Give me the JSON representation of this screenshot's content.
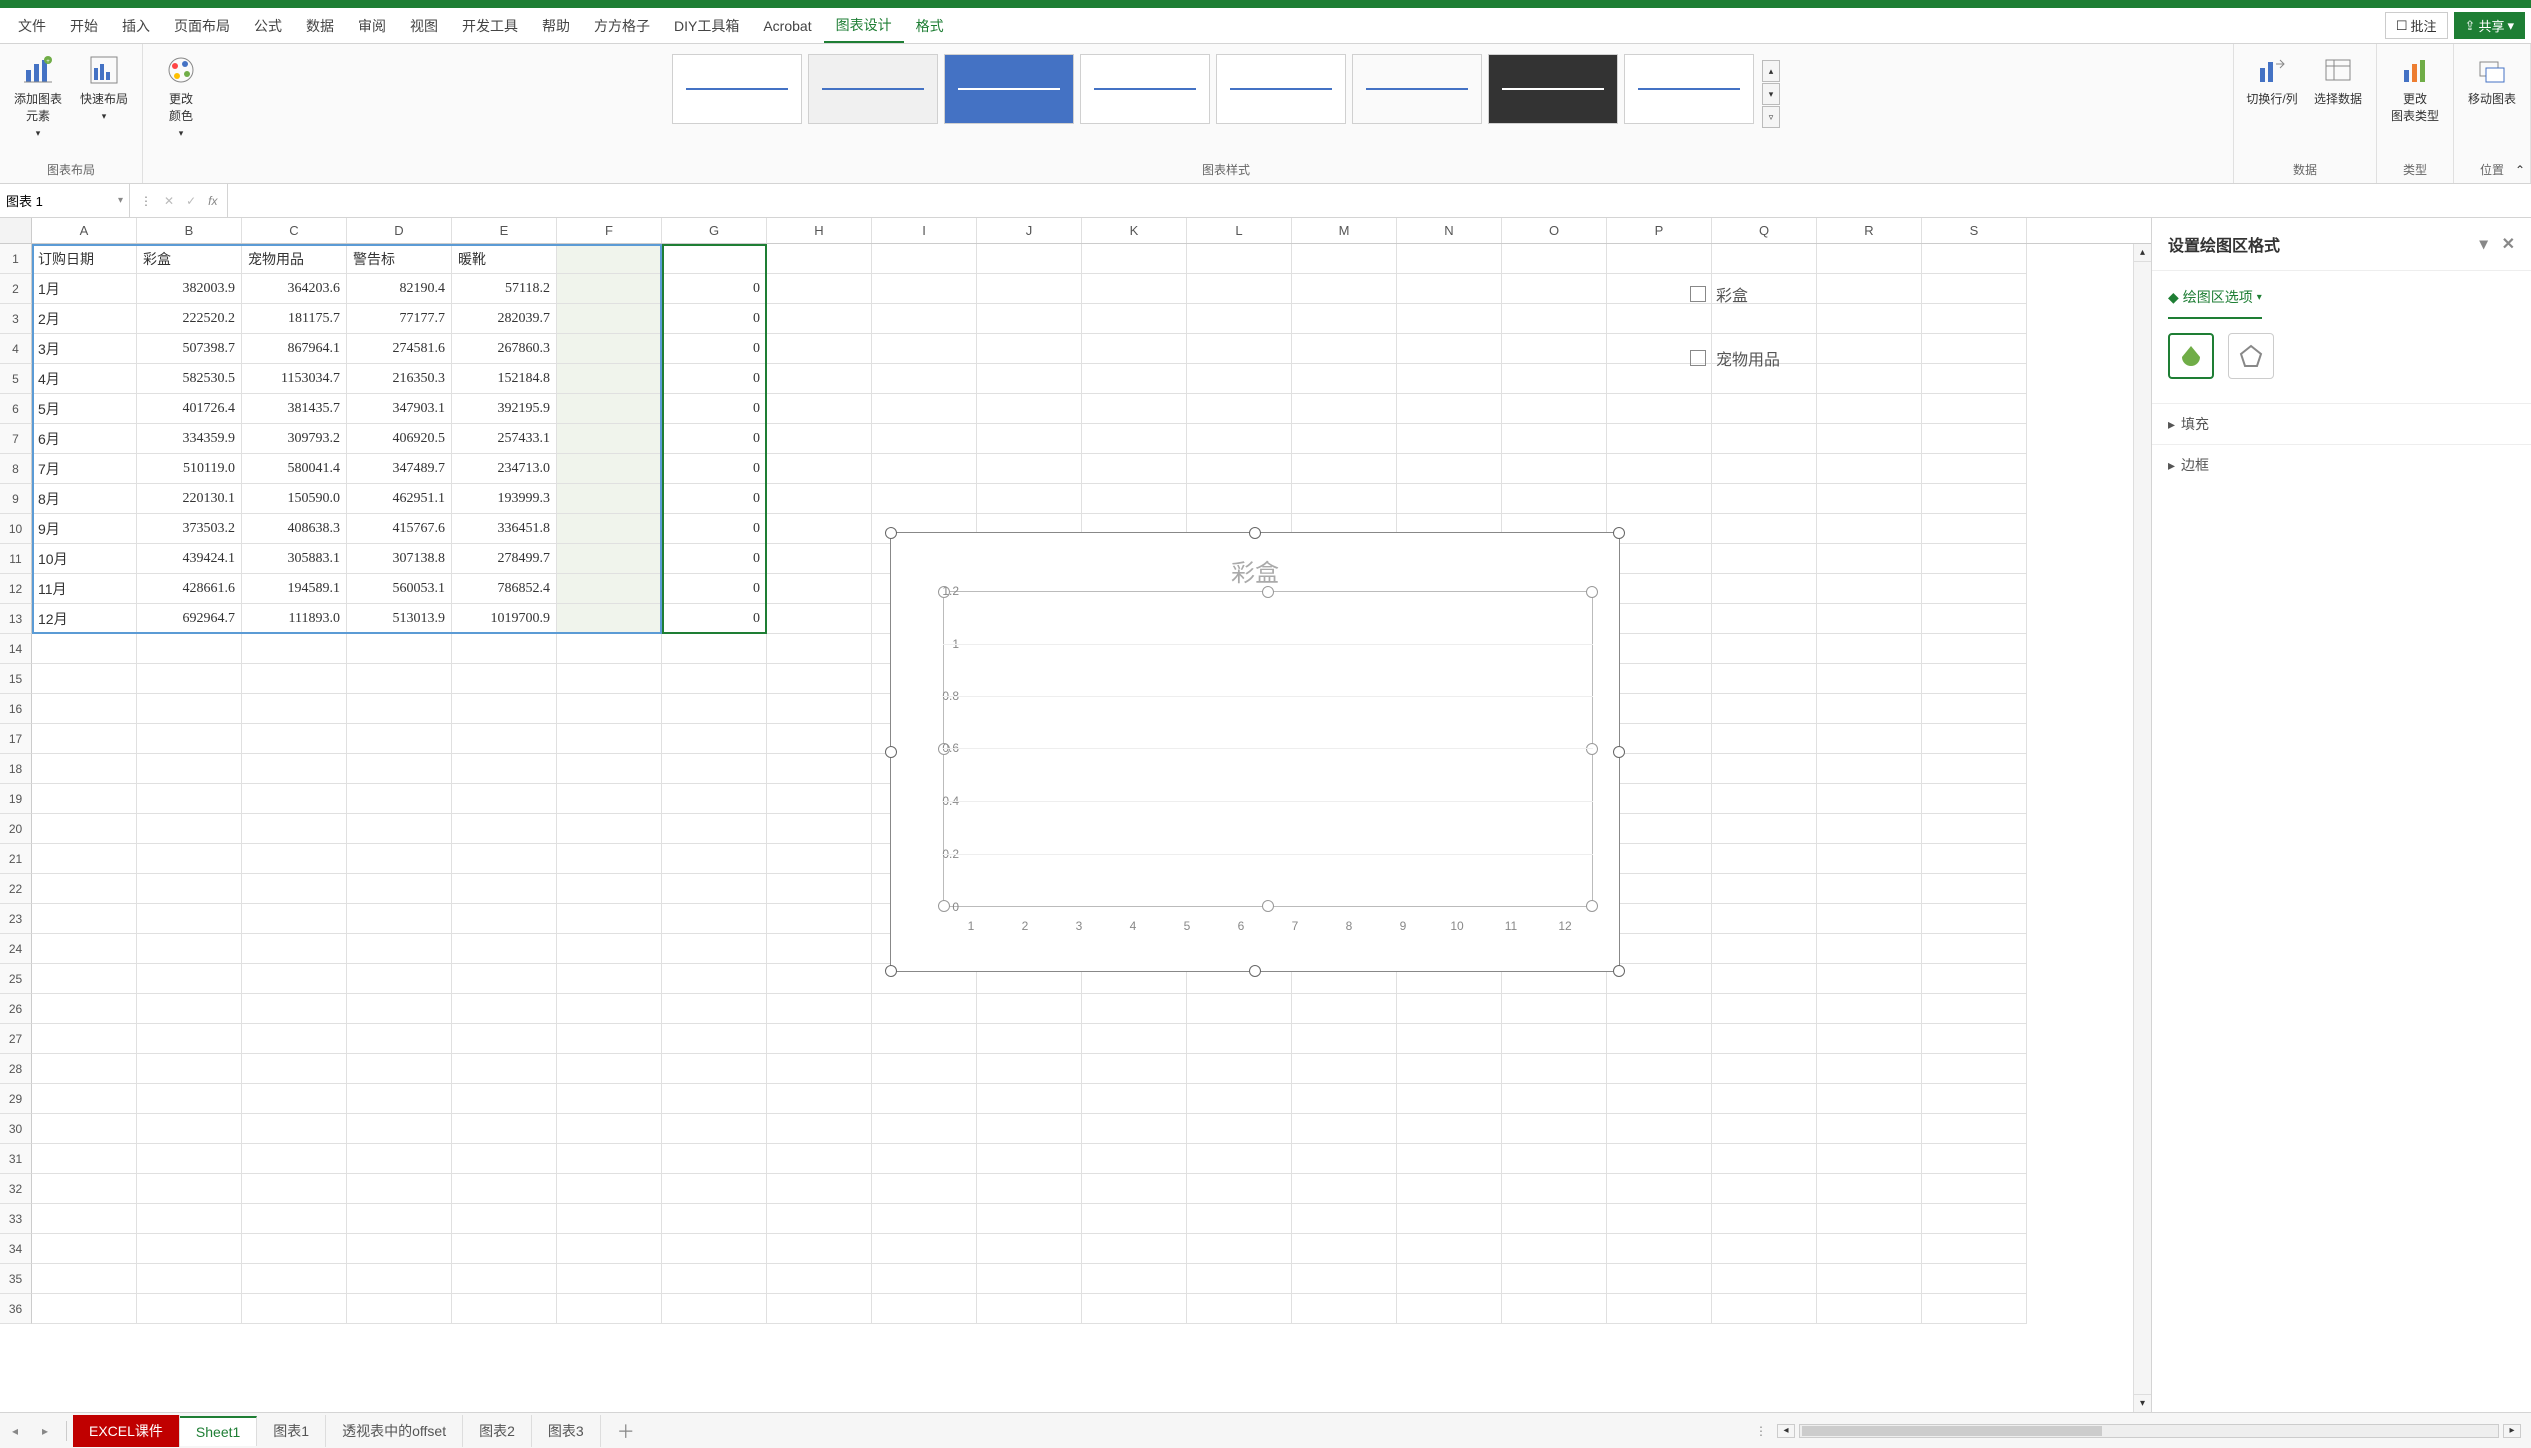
{
  "ribbon": {
    "tabs": [
      "文件",
      "开始",
      "插入",
      "页面布局",
      "公式",
      "数据",
      "审阅",
      "视图",
      "开发工具",
      "帮助",
      "方方格子",
      "DIY工具箱",
      "Acrobat",
      "图表设计",
      "格式"
    ],
    "active_tab": "图表设计",
    "right_buttons": {
      "comments": "批注",
      "share": "共享"
    },
    "groups": {
      "layout_label": "图表布局",
      "styles_label": "图表样式",
      "data_label": "数据",
      "type_label": "类型",
      "location_label": "位置",
      "add_element": "添加图表\n元素",
      "quick_layout": "快速布局",
      "change_colors": "更改\n颜色",
      "switch_rowcol": "切换行/列",
      "select_data": "选择数据",
      "change_type": "更改\n图表类型",
      "move_chart": "移动图表"
    }
  },
  "formula_bar": {
    "name_box": "图表 1",
    "fx_label": "fx",
    "formula": ""
  },
  "columns": [
    "A",
    "B",
    "C",
    "D",
    "E",
    "F",
    "G",
    "H",
    "I",
    "J",
    "K",
    "L",
    "M",
    "N",
    "O",
    "P",
    "Q",
    "R",
    "S"
  ],
  "table": {
    "headers": [
      "订购日期",
      "彩盒",
      "宠物用品",
      "警告标",
      "暖靴"
    ],
    "rows": [
      [
        "1月",
        "382003.9",
        "364203.6",
        "82190.4",
        "57118.2"
      ],
      [
        "2月",
        "222520.2",
        "181175.7",
        "77177.7",
        "282039.7"
      ],
      [
        "3月",
        "507398.7",
        "867964.1",
        "274581.6",
        "267860.3"
      ],
      [
        "4月",
        "582530.5",
        "1153034.7",
        "216350.3",
        "152184.8"
      ],
      [
        "5月",
        "401726.4",
        "381435.7",
        "347903.1",
        "392195.9"
      ],
      [
        "6月",
        "334359.9",
        "309793.2",
        "406920.5",
        "257433.1"
      ],
      [
        "7月",
        "510119.0",
        "580041.4",
        "347489.7",
        "234713.0"
      ],
      [
        "8月",
        "220130.1",
        "150590.0",
        "462951.1",
        "193999.3"
      ],
      [
        "9月",
        "373503.2",
        "408638.3",
        "415767.6",
        "336451.8"
      ],
      [
        "10月",
        "439424.1",
        "305883.1",
        "307138.8",
        "278499.7"
      ],
      [
        "11月",
        "428661.6",
        "194589.1",
        "560053.1",
        "786852.4"
      ],
      [
        "12月",
        "692964.7",
        "111893.0",
        "513013.9",
        "1019700.9"
      ]
    ],
    "g_zero": "0"
  },
  "chart_data": {
    "type": "line",
    "title": "彩盒",
    "x": [
      "1",
      "2",
      "3",
      "4",
      "5",
      "6",
      "7",
      "8",
      "9",
      "10",
      "11",
      "12"
    ],
    "y_ticks": [
      "0",
      "0.2",
      "0.4",
      "0.6",
      "0.8",
      "1",
      "1.2"
    ],
    "ylim": [
      0,
      1.2
    ],
    "series": [],
    "legend": [
      "彩盒",
      "宠物用品"
    ]
  },
  "format_pane": {
    "title": "设置绘图区格式",
    "subtitle": "绘图区选项",
    "fill": "填充",
    "border": "边框"
  },
  "sheet_tabs": {
    "items": [
      "EXCEL课件",
      "Sheet1",
      "图表1",
      "透视表中的offset",
      "图表2",
      "图表3"
    ],
    "active": "Sheet1"
  }
}
